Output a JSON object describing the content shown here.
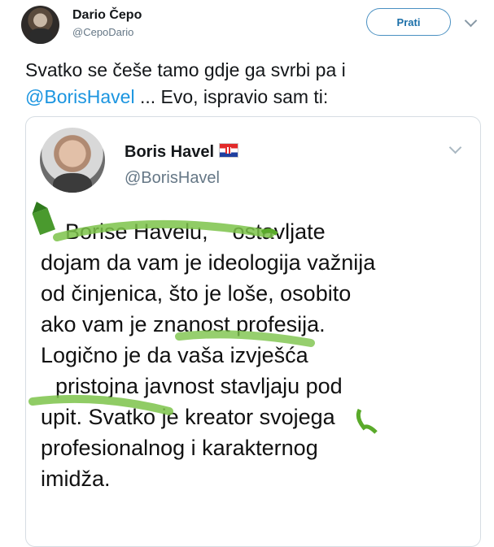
{
  "tweet": {
    "author": {
      "name": "Dario Čepo",
      "handle": "@CepoDario"
    },
    "follow_label": "Prati",
    "text_before": "Svatko se češe tamo gdje ga svrbi pa i",
    "mention": "@BorisHavel",
    "text_after": " ... Evo, ispravio sam ti:"
  },
  "quoted": {
    "author": {
      "name": "Boris Havel",
      "handle": "@BorisHavel"
    },
    "body_lines": [
      "Borise Havelu,    ostavljate",
      "dojam da vam je ideologija važnija",
      "od činjenica, što je loše, osobito",
      "ako vam je znanost profesija.",
      "Logično je da vaša izvješća",
      "pristojna javnost stavljaju pod",
      "upit. Svatko je kreator svojega",
      "profesionalnog i karakternog",
      "imidža."
    ]
  },
  "colors": {
    "accent": "#1b95e0",
    "highlighter": "#7cc34a",
    "border": "#d6dde3"
  },
  "icons": [
    "avatar",
    "chevron-down-icon",
    "croatian-flag-icon",
    "highlighter-marker-icon"
  ]
}
